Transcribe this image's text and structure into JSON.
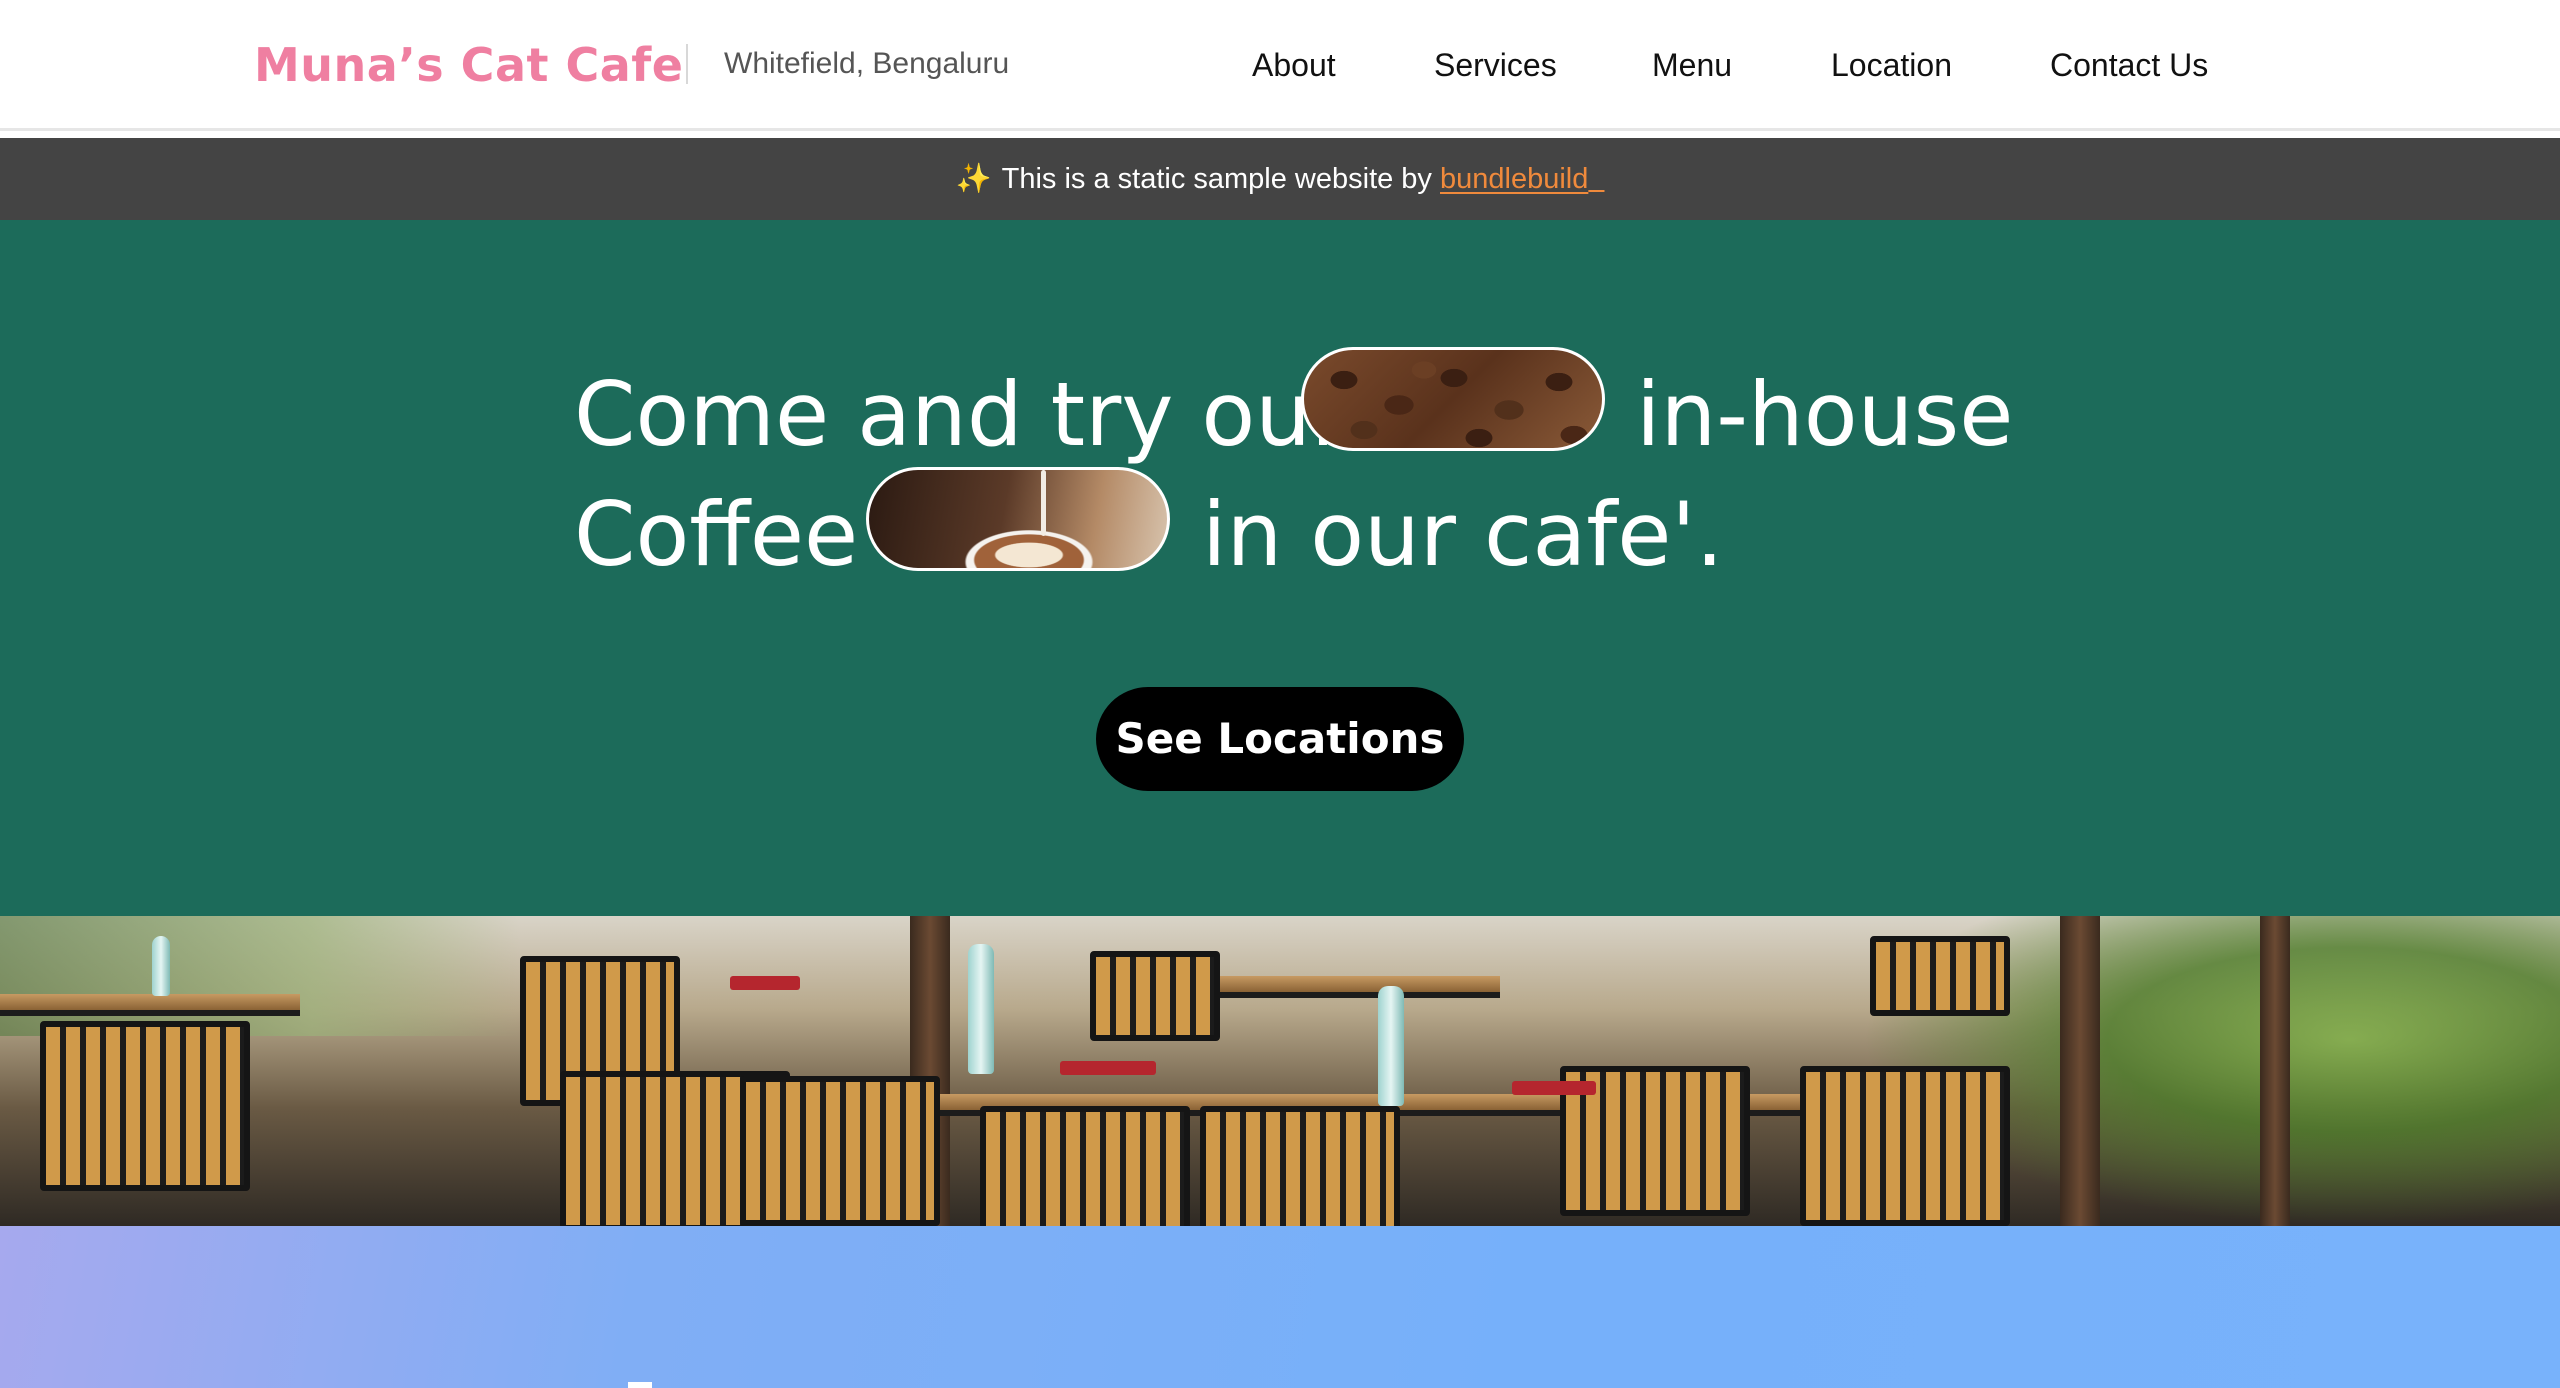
{
  "header": {
    "brand": "Muna’s Cat Cafe",
    "location": "Whitefield, Bengaluru",
    "nav": [
      "About",
      "Services",
      "Menu",
      "Location",
      "Contact Us"
    ]
  },
  "banner": {
    "sparkle_icon": "sparkles-icon",
    "text": "This is a static sample website by",
    "link_text": "bundlebuild"
  },
  "hero": {
    "line1_start": "Come and try our",
    "line1_end": "in-house",
    "line2_start": "Coffee",
    "line2_end": "in our cafe'.",
    "cta_label": "See Locations"
  },
  "colors": {
    "brand_pink": "#ef7fa1",
    "hero_green": "#1c6b5a",
    "banner_gray": "#444444",
    "link_orange": "#f08a3c",
    "cta_black": "#000000",
    "section_blue": "#78b2fb"
  }
}
